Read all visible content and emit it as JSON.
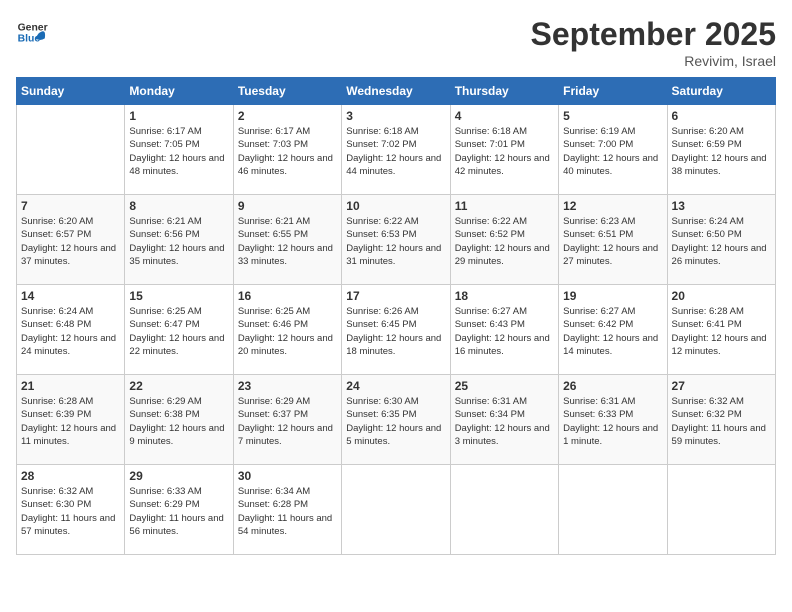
{
  "header": {
    "logo_general": "General",
    "logo_blue": "Blue",
    "month_title": "September 2025",
    "location": "Revivim, Israel"
  },
  "days_of_week": [
    "Sunday",
    "Monday",
    "Tuesday",
    "Wednesday",
    "Thursday",
    "Friday",
    "Saturday"
  ],
  "weeks": [
    [
      {
        "day": "",
        "info": ""
      },
      {
        "day": "1",
        "info": "Sunrise: 6:17 AM\nSunset: 7:05 PM\nDaylight: 12 hours and 48 minutes."
      },
      {
        "day": "2",
        "info": "Sunrise: 6:17 AM\nSunset: 7:03 PM\nDaylight: 12 hours and 46 minutes."
      },
      {
        "day": "3",
        "info": "Sunrise: 6:18 AM\nSunset: 7:02 PM\nDaylight: 12 hours and 44 minutes."
      },
      {
        "day": "4",
        "info": "Sunrise: 6:18 AM\nSunset: 7:01 PM\nDaylight: 12 hours and 42 minutes."
      },
      {
        "day": "5",
        "info": "Sunrise: 6:19 AM\nSunset: 7:00 PM\nDaylight: 12 hours and 40 minutes."
      },
      {
        "day": "6",
        "info": "Sunrise: 6:20 AM\nSunset: 6:59 PM\nDaylight: 12 hours and 38 minutes."
      }
    ],
    [
      {
        "day": "7",
        "info": "Sunrise: 6:20 AM\nSunset: 6:57 PM\nDaylight: 12 hours and 37 minutes."
      },
      {
        "day": "8",
        "info": "Sunrise: 6:21 AM\nSunset: 6:56 PM\nDaylight: 12 hours and 35 minutes."
      },
      {
        "day": "9",
        "info": "Sunrise: 6:21 AM\nSunset: 6:55 PM\nDaylight: 12 hours and 33 minutes."
      },
      {
        "day": "10",
        "info": "Sunrise: 6:22 AM\nSunset: 6:53 PM\nDaylight: 12 hours and 31 minutes."
      },
      {
        "day": "11",
        "info": "Sunrise: 6:22 AM\nSunset: 6:52 PM\nDaylight: 12 hours and 29 minutes."
      },
      {
        "day": "12",
        "info": "Sunrise: 6:23 AM\nSunset: 6:51 PM\nDaylight: 12 hours and 27 minutes."
      },
      {
        "day": "13",
        "info": "Sunrise: 6:24 AM\nSunset: 6:50 PM\nDaylight: 12 hours and 26 minutes."
      }
    ],
    [
      {
        "day": "14",
        "info": "Sunrise: 6:24 AM\nSunset: 6:48 PM\nDaylight: 12 hours and 24 minutes."
      },
      {
        "day": "15",
        "info": "Sunrise: 6:25 AM\nSunset: 6:47 PM\nDaylight: 12 hours and 22 minutes."
      },
      {
        "day": "16",
        "info": "Sunrise: 6:25 AM\nSunset: 6:46 PM\nDaylight: 12 hours and 20 minutes."
      },
      {
        "day": "17",
        "info": "Sunrise: 6:26 AM\nSunset: 6:45 PM\nDaylight: 12 hours and 18 minutes."
      },
      {
        "day": "18",
        "info": "Sunrise: 6:27 AM\nSunset: 6:43 PM\nDaylight: 12 hours and 16 minutes."
      },
      {
        "day": "19",
        "info": "Sunrise: 6:27 AM\nSunset: 6:42 PM\nDaylight: 12 hours and 14 minutes."
      },
      {
        "day": "20",
        "info": "Sunrise: 6:28 AM\nSunset: 6:41 PM\nDaylight: 12 hours and 12 minutes."
      }
    ],
    [
      {
        "day": "21",
        "info": "Sunrise: 6:28 AM\nSunset: 6:39 PM\nDaylight: 12 hours and 11 minutes."
      },
      {
        "day": "22",
        "info": "Sunrise: 6:29 AM\nSunset: 6:38 PM\nDaylight: 12 hours and 9 minutes."
      },
      {
        "day": "23",
        "info": "Sunrise: 6:29 AM\nSunset: 6:37 PM\nDaylight: 12 hours and 7 minutes."
      },
      {
        "day": "24",
        "info": "Sunrise: 6:30 AM\nSunset: 6:35 PM\nDaylight: 12 hours and 5 minutes."
      },
      {
        "day": "25",
        "info": "Sunrise: 6:31 AM\nSunset: 6:34 PM\nDaylight: 12 hours and 3 minutes."
      },
      {
        "day": "26",
        "info": "Sunrise: 6:31 AM\nSunset: 6:33 PM\nDaylight: 12 hours and 1 minute."
      },
      {
        "day": "27",
        "info": "Sunrise: 6:32 AM\nSunset: 6:32 PM\nDaylight: 11 hours and 59 minutes."
      }
    ],
    [
      {
        "day": "28",
        "info": "Sunrise: 6:32 AM\nSunset: 6:30 PM\nDaylight: 11 hours and 57 minutes."
      },
      {
        "day": "29",
        "info": "Sunrise: 6:33 AM\nSunset: 6:29 PM\nDaylight: 11 hours and 56 minutes."
      },
      {
        "day": "30",
        "info": "Sunrise: 6:34 AM\nSunset: 6:28 PM\nDaylight: 11 hours and 54 minutes."
      },
      {
        "day": "",
        "info": ""
      },
      {
        "day": "",
        "info": ""
      },
      {
        "day": "",
        "info": ""
      },
      {
        "day": "",
        "info": ""
      }
    ]
  ]
}
